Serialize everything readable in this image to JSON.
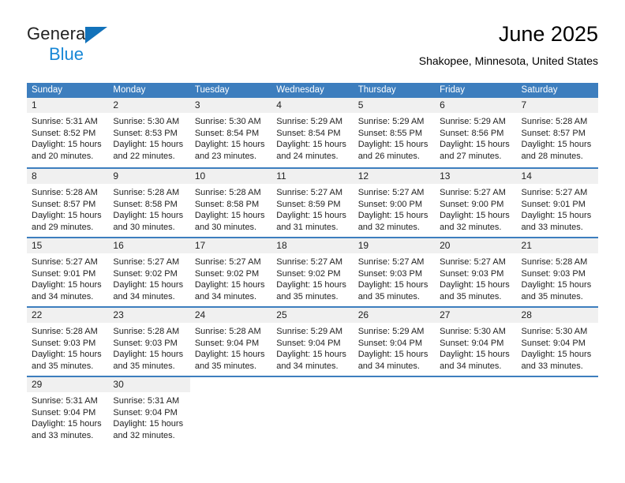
{
  "brand": {
    "name_part1": "General",
    "name_part2": "Blue",
    "triangle_color": "#1272ba",
    "blue_color": "#1787d6"
  },
  "header": {
    "title": "June 2025",
    "subtitle": "Shakopee, Minnesota, United States"
  },
  "colors": {
    "header_row_bg": "#3d7ebe",
    "day_number_band_bg": "#f0f0f0",
    "week_divider": "#3d7ebe",
    "text": "#222222"
  },
  "weekdays": [
    "Sunday",
    "Monday",
    "Tuesday",
    "Wednesday",
    "Thursday",
    "Friday",
    "Saturday"
  ],
  "weeks": [
    [
      {
        "day": "1",
        "sunrise": "Sunrise: 5:31 AM",
        "sunset": "Sunset: 8:52 PM",
        "daylight_l1": "Daylight: 15 hours",
        "daylight_l2": "and 20 minutes."
      },
      {
        "day": "2",
        "sunrise": "Sunrise: 5:30 AM",
        "sunset": "Sunset: 8:53 PM",
        "daylight_l1": "Daylight: 15 hours",
        "daylight_l2": "and 22 minutes."
      },
      {
        "day": "3",
        "sunrise": "Sunrise: 5:30 AM",
        "sunset": "Sunset: 8:54 PM",
        "daylight_l1": "Daylight: 15 hours",
        "daylight_l2": "and 23 minutes."
      },
      {
        "day": "4",
        "sunrise": "Sunrise: 5:29 AM",
        "sunset": "Sunset: 8:54 PM",
        "daylight_l1": "Daylight: 15 hours",
        "daylight_l2": "and 24 minutes."
      },
      {
        "day": "5",
        "sunrise": "Sunrise: 5:29 AM",
        "sunset": "Sunset: 8:55 PM",
        "daylight_l1": "Daylight: 15 hours",
        "daylight_l2": "and 26 minutes."
      },
      {
        "day": "6",
        "sunrise": "Sunrise: 5:29 AM",
        "sunset": "Sunset: 8:56 PM",
        "daylight_l1": "Daylight: 15 hours",
        "daylight_l2": "and 27 minutes."
      },
      {
        "day": "7",
        "sunrise": "Sunrise: 5:28 AM",
        "sunset": "Sunset: 8:57 PM",
        "daylight_l1": "Daylight: 15 hours",
        "daylight_l2": "and 28 minutes."
      }
    ],
    [
      {
        "day": "8",
        "sunrise": "Sunrise: 5:28 AM",
        "sunset": "Sunset: 8:57 PM",
        "daylight_l1": "Daylight: 15 hours",
        "daylight_l2": "and 29 minutes."
      },
      {
        "day": "9",
        "sunrise": "Sunrise: 5:28 AM",
        "sunset": "Sunset: 8:58 PM",
        "daylight_l1": "Daylight: 15 hours",
        "daylight_l2": "and 30 minutes."
      },
      {
        "day": "10",
        "sunrise": "Sunrise: 5:28 AM",
        "sunset": "Sunset: 8:58 PM",
        "daylight_l1": "Daylight: 15 hours",
        "daylight_l2": "and 30 minutes."
      },
      {
        "day": "11",
        "sunrise": "Sunrise: 5:27 AM",
        "sunset": "Sunset: 8:59 PM",
        "daylight_l1": "Daylight: 15 hours",
        "daylight_l2": "and 31 minutes."
      },
      {
        "day": "12",
        "sunrise": "Sunrise: 5:27 AM",
        "sunset": "Sunset: 9:00 PM",
        "daylight_l1": "Daylight: 15 hours",
        "daylight_l2": "and 32 minutes."
      },
      {
        "day": "13",
        "sunrise": "Sunrise: 5:27 AM",
        "sunset": "Sunset: 9:00 PM",
        "daylight_l1": "Daylight: 15 hours",
        "daylight_l2": "and 32 minutes."
      },
      {
        "day": "14",
        "sunrise": "Sunrise: 5:27 AM",
        "sunset": "Sunset: 9:01 PM",
        "daylight_l1": "Daylight: 15 hours",
        "daylight_l2": "and 33 minutes."
      }
    ],
    [
      {
        "day": "15",
        "sunrise": "Sunrise: 5:27 AM",
        "sunset": "Sunset: 9:01 PM",
        "daylight_l1": "Daylight: 15 hours",
        "daylight_l2": "and 34 minutes."
      },
      {
        "day": "16",
        "sunrise": "Sunrise: 5:27 AM",
        "sunset": "Sunset: 9:02 PM",
        "daylight_l1": "Daylight: 15 hours",
        "daylight_l2": "and 34 minutes."
      },
      {
        "day": "17",
        "sunrise": "Sunrise: 5:27 AM",
        "sunset": "Sunset: 9:02 PM",
        "daylight_l1": "Daylight: 15 hours",
        "daylight_l2": "and 34 minutes."
      },
      {
        "day": "18",
        "sunrise": "Sunrise: 5:27 AM",
        "sunset": "Sunset: 9:02 PM",
        "daylight_l1": "Daylight: 15 hours",
        "daylight_l2": "and 35 minutes."
      },
      {
        "day": "19",
        "sunrise": "Sunrise: 5:27 AM",
        "sunset": "Sunset: 9:03 PM",
        "daylight_l1": "Daylight: 15 hours",
        "daylight_l2": "and 35 minutes."
      },
      {
        "day": "20",
        "sunrise": "Sunrise: 5:27 AM",
        "sunset": "Sunset: 9:03 PM",
        "daylight_l1": "Daylight: 15 hours",
        "daylight_l2": "and 35 minutes."
      },
      {
        "day": "21",
        "sunrise": "Sunrise: 5:28 AM",
        "sunset": "Sunset: 9:03 PM",
        "daylight_l1": "Daylight: 15 hours",
        "daylight_l2": "and 35 minutes."
      }
    ],
    [
      {
        "day": "22",
        "sunrise": "Sunrise: 5:28 AM",
        "sunset": "Sunset: 9:03 PM",
        "daylight_l1": "Daylight: 15 hours",
        "daylight_l2": "and 35 minutes."
      },
      {
        "day": "23",
        "sunrise": "Sunrise: 5:28 AM",
        "sunset": "Sunset: 9:03 PM",
        "daylight_l1": "Daylight: 15 hours",
        "daylight_l2": "and 35 minutes."
      },
      {
        "day": "24",
        "sunrise": "Sunrise: 5:28 AM",
        "sunset": "Sunset: 9:04 PM",
        "daylight_l1": "Daylight: 15 hours",
        "daylight_l2": "and 35 minutes."
      },
      {
        "day": "25",
        "sunrise": "Sunrise: 5:29 AM",
        "sunset": "Sunset: 9:04 PM",
        "daylight_l1": "Daylight: 15 hours",
        "daylight_l2": "and 34 minutes."
      },
      {
        "day": "26",
        "sunrise": "Sunrise: 5:29 AM",
        "sunset": "Sunset: 9:04 PM",
        "daylight_l1": "Daylight: 15 hours",
        "daylight_l2": "and 34 minutes."
      },
      {
        "day": "27",
        "sunrise": "Sunrise: 5:30 AM",
        "sunset": "Sunset: 9:04 PM",
        "daylight_l1": "Daylight: 15 hours",
        "daylight_l2": "and 34 minutes."
      },
      {
        "day": "28",
        "sunrise": "Sunrise: 5:30 AM",
        "sunset": "Sunset: 9:04 PM",
        "daylight_l1": "Daylight: 15 hours",
        "daylight_l2": "and 33 minutes."
      }
    ],
    [
      {
        "day": "29",
        "sunrise": "Sunrise: 5:31 AM",
        "sunset": "Sunset: 9:04 PM",
        "daylight_l1": "Daylight: 15 hours",
        "daylight_l2": "and 33 minutes."
      },
      {
        "day": "30",
        "sunrise": "Sunrise: 5:31 AM",
        "sunset": "Sunset: 9:04 PM",
        "daylight_l1": "Daylight: 15 hours",
        "daylight_l2": "and 32 minutes."
      },
      {
        "day": "",
        "sunrise": "",
        "sunset": "",
        "daylight_l1": "",
        "daylight_l2": ""
      },
      {
        "day": "",
        "sunrise": "",
        "sunset": "",
        "daylight_l1": "",
        "daylight_l2": ""
      },
      {
        "day": "",
        "sunrise": "",
        "sunset": "",
        "daylight_l1": "",
        "daylight_l2": ""
      },
      {
        "day": "",
        "sunrise": "",
        "sunset": "",
        "daylight_l1": "",
        "daylight_l2": ""
      },
      {
        "day": "",
        "sunrise": "",
        "sunset": "",
        "daylight_l1": "",
        "daylight_l2": ""
      }
    ]
  ]
}
